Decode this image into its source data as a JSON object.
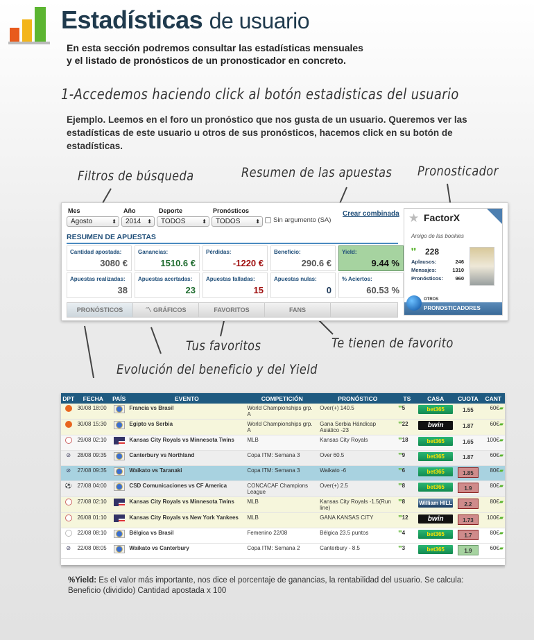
{
  "header": {
    "title_bold": "Estadísticas",
    "title_light": "de usuario",
    "subtitle": [
      "En esta sección podremos consultar las estadísticas mensuales",
      "y el listado de pronósticos de un pronosticador en concreto."
    ]
  },
  "step1": "1-Accedemos haciendo click al botón estadisticas del usuario",
  "example": "Ejemplo. Leemos en el foro un pronóstico que nos gusta de un usuario. Queremos ver las estadísticas de este usuario u otros de sus pronósticos, hacemos click en su botón de estadísticas.",
  "annotations": {
    "filters": "Filtros de búsqueda",
    "summary": "Resumen de las apuestas",
    "tipster": "Pronosticador",
    "favorites": "Tus favoritos",
    "fans": "Te tienen de favorito",
    "evolution": "Evolución del beneficio y del Yield"
  },
  "filters": {
    "mes_label": "Mes",
    "mes": "Agosto",
    "ano_label": "Año",
    "ano": "2014",
    "deporte_label": "Deporte",
    "deporte": "TODOS",
    "pron_label": "Pronósticos",
    "pron": "TODOS",
    "sa_label": "Sin argumento (SA)",
    "crear": "Crear combinada"
  },
  "summary": {
    "title": "RESUMEN DE APUESTAS",
    "boxes": [
      {
        "label": "Cantidad apostada:",
        "value": "3080 €",
        "color": "#555555"
      },
      {
        "label": "Ganancias:",
        "value": "1510.6 €",
        "color": "#1e6b2e"
      },
      {
        "label": "Pérdidas:",
        "value": "-1220 €",
        "color": "#a01010"
      },
      {
        "label": "Beneficio:",
        "value": "290.6 €",
        "color": "#555555"
      },
      {
        "label": "Yield:",
        "value": "9.44 %",
        "color": "#111111"
      },
      {
        "label": "Apuestas realizadas:",
        "value": "38",
        "color": "#555555"
      },
      {
        "label": "Apuestas acertadas:",
        "value": "23",
        "color": "#1e6b2e"
      },
      {
        "label": "Apuestas falladas:",
        "value": "15",
        "color": "#a01010"
      },
      {
        "label": "Apuestas nulas:",
        "value": "0",
        "color": "#1e3a5a"
      },
      {
        "label": "% Aciertos:",
        "value": "60.53 %",
        "color": "#555555"
      }
    ]
  },
  "tabs": [
    "PRONÓSTICOS",
    "GRÁFICOS",
    "FAVORITOS",
    "FANS"
  ],
  "card": {
    "name": "FactorX",
    "motto": "Amigo de las bookies",
    "score": "228",
    "stats": [
      {
        "label": "Aplausos:",
        "value": "246"
      },
      {
        "label": "Mensajes:",
        "value": "1310"
      },
      {
        "label": "Pronósticos:",
        "value": "960"
      }
    ],
    "otros": "OTROS",
    "pronosticadores": "PRONOSTICADORES"
  },
  "table": {
    "headers": [
      "DPT",
      "FECHA",
      "PAÍS",
      "EVENTO",
      "COMPETICIÓN",
      "PRONÓSTICO",
      "TS",
      "CASA",
      "CUOTA",
      "CANT"
    ],
    "rows": [
      {
        "sport": "basketball",
        "fecha": "30/08 18:00",
        "pais": "world",
        "evento": "Francia vs Brasil",
        "comp": "World Championships grp. A",
        "pron": "Over(+) 140.5",
        "ts": "5",
        "casa": "bet365",
        "cuota": "1.55",
        "cuota_state": "none",
        "cant": "60€",
        "bg": "#f6f6dc"
      },
      {
        "sport": "basketball",
        "fecha": "30/08 15:30",
        "pais": "world",
        "evento": "Egipto vs Serbia",
        "comp": "World Championships grp. A",
        "pron": "Gana Serbia Hándicap Asiático -23",
        "ts": "22",
        "casa": "bwin",
        "cuota": "1.87",
        "cuota_state": "none",
        "cant": "60€",
        "bg": "#f6f6dc"
      },
      {
        "sport": "baseball",
        "fecha": "29/08 02:10",
        "pais": "usa",
        "evento": "Kansas City Royals vs Minnesota Twins",
        "comp": "MLB",
        "pron": "Kansas City Royals",
        "ts": "18",
        "casa": "bet365",
        "cuota": "1.65",
        "cuota_state": "none",
        "cant": "100€",
        "bg": "#f7f7f7"
      },
      {
        "sport": "rugby",
        "fecha": "28/08 09:35",
        "pais": "world",
        "evento": "Canterbury vs Northland",
        "comp": "Copa ITM: Semana 3",
        "pron": "Over 60.5",
        "ts": "9",
        "casa": "bet365",
        "cuota": "1.87",
        "cuota_state": "none",
        "cant": "60€",
        "bg": "#eeeeee"
      },
      {
        "sport": "rugby",
        "fecha": "27/08 09:35",
        "pais": "world",
        "evento": "Waikato vs Taranaki",
        "comp": "Copa ITM: Semana 3",
        "pron": "Waikato -6",
        "ts": "6",
        "casa": "bet365",
        "cuota": "1.85",
        "cuota_state": "lost",
        "cant": "80€",
        "bg": "#a8d2e0"
      },
      {
        "sport": "soccer",
        "fecha": "27/08 04:00",
        "pais": "world",
        "evento": "CSD Comunicaciones vs CF America",
        "comp": "CONCACAF Champions League",
        "pron": "Over(+) 2.5",
        "ts": "8",
        "casa": "bet365",
        "cuota": "1.9",
        "cuota_state": "lost",
        "cant": "80€",
        "bg": "#eeeeee"
      },
      {
        "sport": "baseball",
        "fecha": "27/08 02:10",
        "pais": "usa",
        "evento": "Kansas City Royals vs Minnesota Twins",
        "comp": "MLB",
        "pron": "Kansas City Royals -1.5(Run line)",
        "ts": "8",
        "casa": "William HILL",
        "cuota": "2.2",
        "cuota_state": "lost",
        "cant": "80€",
        "bg": "#f6f6dc"
      },
      {
        "sport": "baseball",
        "fecha": "26/08 01:10",
        "pais": "usa",
        "evento": "Kansas City Royals vs New York Yankees",
        "comp": "MLB",
        "pron": "GANA KANSAS CITY",
        "ts": "12",
        "casa": "bwin",
        "cuota": "1.73",
        "cuota_state": "lost",
        "cant": "100€",
        "bg": "#f6f6dc"
      },
      {
        "sport": "volleyball",
        "fecha": "22/08 08:10",
        "pais": "world",
        "evento": "Bélgica vs Brasil",
        "comp": "Femenino 22/08",
        "pron": "Bélgica 23.5 puntos",
        "ts": "4",
        "casa": "bet365",
        "cuota": "1.7",
        "cuota_state": "lost",
        "cant": "80€",
        "bg": "#ffffff"
      },
      {
        "sport": "rugby",
        "fecha": "22/08 08:05",
        "pais": "world",
        "evento": "Waikato vs Canterbury",
        "comp": "Copa ITM: Semana 2",
        "pron": "Canterbury - 8.5",
        "ts": "3",
        "casa": "bet365",
        "cuota": "1.9",
        "cuota_state": "won",
        "cant": "60€",
        "bg": "#ffffff"
      }
    ]
  },
  "footer": {
    "term": "%Yield:",
    "text": " Es el valor más importante, nos dice el porcentaje de ganancias, la rentabilidad del usuario.  Se calcula: Beneficio (dividido) Cantidad apostada x 100"
  }
}
